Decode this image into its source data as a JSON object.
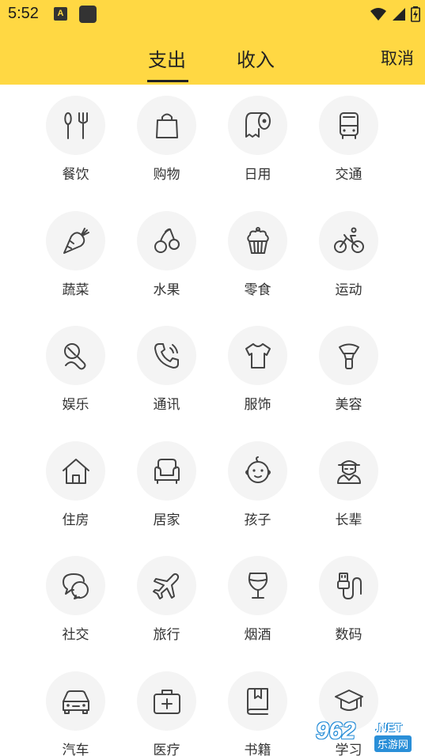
{
  "status_bar": {
    "time": "5:52",
    "notif_a": "A"
  },
  "tabs": [
    {
      "label": "支出",
      "active": true
    },
    {
      "label": "收入",
      "active": false
    }
  ],
  "cancel_label": "取消",
  "colors": {
    "header": "#FFD843",
    "circle": "#F4F4F4",
    "icon_stroke": "#444444"
  },
  "categories": [
    {
      "label": "餐饮",
      "icon": "utensils-icon"
    },
    {
      "label": "购物",
      "icon": "shopping-bag-icon"
    },
    {
      "label": "日用",
      "icon": "toilet-paper-icon"
    },
    {
      "label": "交通",
      "icon": "bus-icon"
    },
    {
      "label": "蔬菜",
      "icon": "carrot-icon"
    },
    {
      "label": "水果",
      "icon": "cherry-icon"
    },
    {
      "label": "零食",
      "icon": "cupcake-icon"
    },
    {
      "label": "运动",
      "icon": "bicycle-icon"
    },
    {
      "label": "娱乐",
      "icon": "microphone-icon"
    },
    {
      "label": "通讯",
      "icon": "phone-icon"
    },
    {
      "label": "服饰",
      "icon": "tshirt-icon"
    },
    {
      "label": "美容",
      "icon": "makeup-brush-icon"
    },
    {
      "label": "住房",
      "icon": "house-icon"
    },
    {
      "label": "居家",
      "icon": "sofa-icon"
    },
    {
      "label": "孩子",
      "icon": "baby-face-icon"
    },
    {
      "label": "长辈",
      "icon": "elder-icon"
    },
    {
      "label": "社交",
      "icon": "chat-bubbles-icon"
    },
    {
      "label": "旅行",
      "icon": "airplane-icon"
    },
    {
      "label": "烟酒",
      "icon": "wine-glass-icon"
    },
    {
      "label": "数码",
      "icon": "usb-cable-icon"
    },
    {
      "label": "汽车",
      "icon": "car-icon"
    },
    {
      "label": "医疗",
      "icon": "medical-kit-icon"
    },
    {
      "label": "书籍",
      "icon": "book-icon"
    },
    {
      "label": "学习",
      "icon": "graduation-cap-icon"
    }
  ],
  "watermark": {
    "number": "962",
    "suffix": ".NET",
    "site": "乐游网"
  }
}
